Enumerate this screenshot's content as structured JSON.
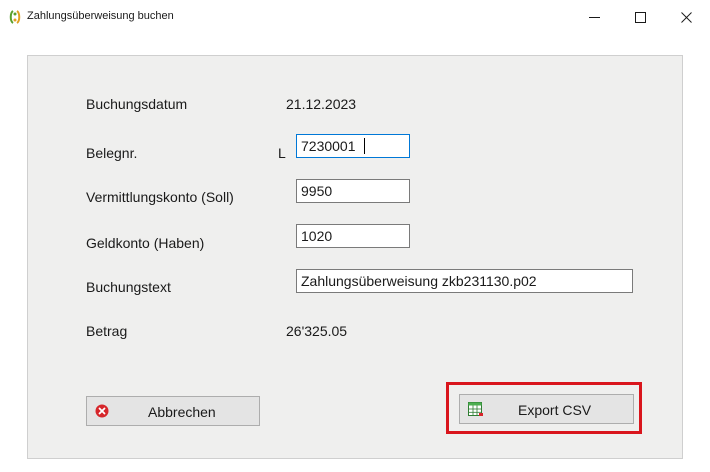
{
  "window": {
    "title": "Zahlungsüberweisung buchen",
    "app_icon": "app-logo-icon",
    "controls": [
      "minimize-icon",
      "maximize-icon",
      "close-icon"
    ]
  },
  "form": {
    "buchungsdatum": {
      "label": "Buchungsdatum",
      "value": "21.12.2023"
    },
    "belegnr": {
      "label": "Belegnr.",
      "prefix": "L",
      "value": "7230001"
    },
    "vermittlungskonto": {
      "label": "Vermittlungskonto (Soll)",
      "value": "9950"
    },
    "geldkonto": {
      "label": "Geldkonto (Haben)",
      "value": "1020"
    },
    "buchungstext": {
      "label": "Buchungstext",
      "value": "Zahlungsüberweisung zkb231130.p02"
    },
    "betrag": {
      "label": "Betrag",
      "value": "26'325.05"
    }
  },
  "buttons": {
    "cancel": {
      "label": "Abbrechen",
      "icon": "cancel-x-icon"
    },
    "export": {
      "label": "Export CSV",
      "icon": "spreadsheet-icon"
    }
  },
  "colors": {
    "highlight": "#d9151c",
    "panel": "#efefee",
    "cancel_icon": "#d6262b",
    "focus": "#0078d7"
  }
}
